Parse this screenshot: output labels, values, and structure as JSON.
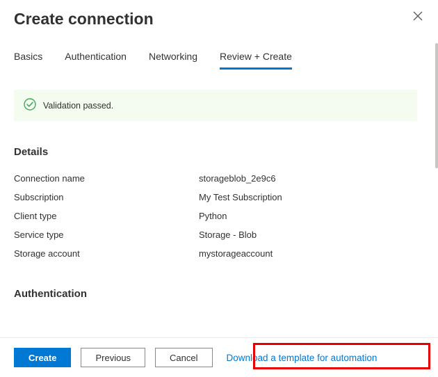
{
  "header": {
    "title": "Create connection"
  },
  "tabs": [
    {
      "label": "Basics",
      "active": false
    },
    {
      "label": "Authentication",
      "active": false
    },
    {
      "label": "Networking",
      "active": false
    },
    {
      "label": "Review + Create",
      "active": true
    }
  ],
  "validation": {
    "message": "Validation passed."
  },
  "sections": {
    "details": {
      "title": "Details",
      "rows": [
        {
          "key": "Connection name",
          "val": "storageblob_2e9c6"
        },
        {
          "key": "Subscription",
          "val": "My Test Subscription"
        },
        {
          "key": "Client type",
          "val": "Python"
        },
        {
          "key": "Service type",
          "val": "Storage - Blob"
        },
        {
          "key": "Storage account",
          "val": "mystorageaccount"
        }
      ]
    },
    "auth": {
      "title": "Authentication"
    }
  },
  "footer": {
    "create": "Create",
    "previous": "Previous",
    "cancel": "Cancel",
    "download_link": "Download a template for automation"
  },
  "colors": {
    "accent": "#0078d4",
    "success": "#4aa564"
  }
}
